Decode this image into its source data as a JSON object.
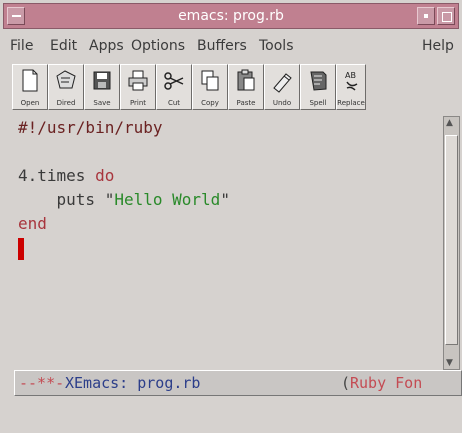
{
  "window": {
    "title": "emacs: prog.rb"
  },
  "menu": {
    "items": [
      "File",
      "Edit",
      "Apps",
      "Options",
      "Buffers",
      "Tools"
    ],
    "help": "Help"
  },
  "toolbar": {
    "buttons": [
      {
        "label": "Open",
        "icon": "open-icon"
      },
      {
        "label": "Dired",
        "icon": "dired-icon"
      },
      {
        "label": "Save",
        "icon": "save-icon"
      },
      {
        "label": "Print",
        "icon": "print-icon"
      },
      {
        "label": "Cut",
        "icon": "cut-icon"
      },
      {
        "label": "Copy",
        "icon": "copy-icon"
      },
      {
        "label": "Paste",
        "icon": "paste-icon"
      },
      {
        "label": "Undo",
        "icon": "undo-icon"
      },
      {
        "label": "Spell",
        "icon": "spell-icon"
      },
      {
        "label": "Replace",
        "icon": "replace-icon"
      }
    ]
  },
  "editor": {
    "shebang": "#!/usr/bin/ruby",
    "line2_pre": "4.times ",
    "line2_kw": "do",
    "line3_pre": "    puts ",
    "line3_q1": "\"",
    "line3_str": "Hello World",
    "line3_q2": "\"",
    "line4": "end"
  },
  "modeline": {
    "status": "--**-",
    "buffer": "XEmacs: prog.rb",
    "mode_open": "(",
    "mode": "Ruby Fon"
  },
  "colors": {
    "titlebar": "#c08090",
    "keyword": "#a8353d",
    "string": "#2a8a2a",
    "cursor": "#cc0000"
  }
}
